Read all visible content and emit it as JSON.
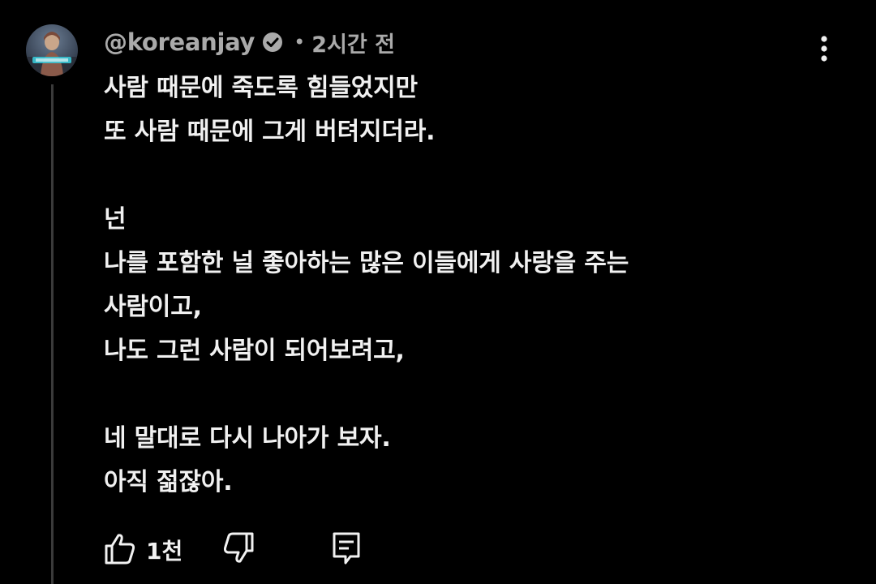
{
  "comment": {
    "author": "@koreanjay",
    "verified": true,
    "separator": "•",
    "timestamp": "2시간 전",
    "body": "사람 때문에 죽도록 힘들었지만\n또 사람 때문에 그게 버텨지더라.\n\n넌\n나를 포함한 널 좋아하는 많은 이들에게 사랑을 주는\n사람이고,\n나도 그런 사람이 되어보려고,\n\n네 말대로 다시 나아가 보자.\n아직 젊잖아.",
    "like_count": "1천"
  },
  "icons": {
    "avatar": "avatar-image",
    "verified": "verified-check-icon",
    "more": "more-vertical-icon",
    "like": "thumbs-up-icon",
    "dislike": "thumbs-down-icon",
    "reply": "comment-reply-icon"
  },
  "colors": {
    "background": "#000000",
    "primary_text": "#f1f1f1",
    "secondary_text": "#aaaaaa",
    "thread_line": "#3a3a3a"
  }
}
